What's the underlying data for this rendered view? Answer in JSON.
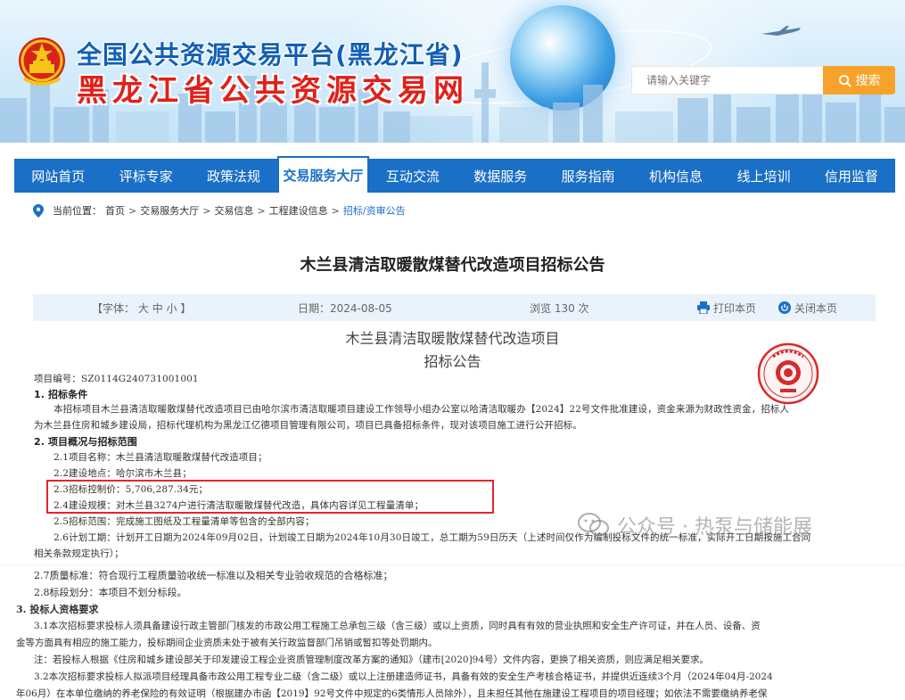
{
  "header": {
    "title_top": "全国公共资源交易平台(黑龙江省)",
    "title_main": "黑龙江省公共资源交易网",
    "search": {
      "placeholder": "请输入关键字",
      "button_label": "搜索"
    }
  },
  "nav": {
    "items": [
      {
        "label": "网站首页",
        "active": false
      },
      {
        "label": "评标专家",
        "active": false
      },
      {
        "label": "政策法规",
        "active": false
      },
      {
        "label": "交易服务大厅",
        "active": true
      },
      {
        "label": "互动交流",
        "active": false
      },
      {
        "label": "数据服务",
        "active": false
      },
      {
        "label": "服务指南",
        "active": false
      },
      {
        "label": "机构信息",
        "active": false
      },
      {
        "label": "线上培训",
        "active": false
      },
      {
        "label": "信用监督",
        "active": false
      }
    ]
  },
  "breadcrumb": {
    "prefix": "当前位置：",
    "items": [
      "首页",
      "交易服务大厅",
      "交易信息",
      "工程建设信息"
    ],
    "current": "招标/资审公告",
    "separator": ">"
  },
  "article": {
    "title": "木兰县清洁取暖散煤替代改造项目招标公告",
    "font_size_label": "【字体：",
    "font_size_options": [
      "大",
      "中",
      "小"
    ],
    "font_size_end": "】",
    "date": "日期：2024-08-05",
    "views": "浏览 130 次",
    "print_label": "打印本页",
    "close_label": "关闭本页"
  },
  "doc": {
    "title_line1": "木兰县清洁取暖散煤替代改造项目",
    "title_line2": "招标公告",
    "project_no": "项目编号：SZ0114G240731001001",
    "s1_heading": "1. 招标条件",
    "s1_p1": "本招标项目木兰县清洁取暖散煤替代改造项目已由哈尔滨市清洁取暖项目建设工作领导小组办公室以哈清洁取暖办【2024】22号文件批准建设，资金来源为财政性资金，招标人",
    "s1_p2": "为木兰县住房和城乡建设局，招标代理机构为黑龙江亿德项目管理有限公司，项目已具备招标条件，现对该项目施工进行公开招标。",
    "s2_heading": "2. 项目概况与招标范围",
    "s2_1": "2.1项目名称：木兰县清洁取暖散煤替代改造项目；",
    "s2_2": "2.2建设地点：哈尔滨市木兰县；",
    "s2_3": "2.3招标控制价：5,706,287.34元；",
    "s2_4": "2.4建设规模：对木兰县3274户进行清洁取暖散煤替代改造，具体内容详见工程量清单；",
    "s2_5": "2.5招标范围：完成施工图纸及工程量清单等包含的全部内容；",
    "s2_6a": "2.6计划工期：计划开工日期为2024年09月02日，计划竣工日期为2024年10月30日竣工，总工期为59日历天（上述时间仅作为编制投标文件的统一标准，实际开工日期按施工合同",
    "s2_6b": "相关条款规定执行）；",
    "s2_7": "2.7质量标准：符合现行工程质量验收统一标准以及相关专业验收规范的合格标准；",
    "s2_8": "2.8标段划分：本项目不划分标段。",
    "s3_heading": "3. 投标人资格要求",
    "s3_1a": "3.1本次招标要求投标人须具备建设行政主管部门核发的市政公用工程施工总承包三级（含三级）或以上资质，同时具有有效的营业执照和安全生产许可证，并在人员、设备、资",
    "s3_1b": "金等方面具有相应的施工能力，投标期间企业资质未处于被有关行政监督部门吊销或暂扣等处罚期内。",
    "s3_note": "注：若投标人根据《住房和城乡建设部关于印发建设工程企业资质管理制度改革方案的通知》（建市[2020]94号）文件内容，更换了相关资质，则应满足相关要求。",
    "s3_2a": "3.2本次招标要求投标人拟派项目经理具备市政公用工程专业二级（含二级）或以上注册建造师证书，具备有效的安全生产考核合格证书，并提供近连续3个月（2024年04月-2024",
    "s3_2b": "年06月）在本单位缴纳的养老保险的有效证明（根据建办市函【2019】92号文件中规定的6类情形人员除外），且未担任其他在施建设工程项目的项目经理；如依法不需要缴纳养老保"
  },
  "watermark": {
    "text": "公众号 · 热泵与储能展"
  },
  "colors": {
    "nav_blue": "#1a6fc6",
    "search_orange": "#f7a32a",
    "highlight_red": "#e3262a",
    "title_red": "#e0201a"
  },
  "icons": [
    "national-emblem-icon",
    "search-icon",
    "location-pin-icon",
    "print-icon",
    "close-circle-icon",
    "official-seal-icon",
    "wechat-icon"
  ]
}
